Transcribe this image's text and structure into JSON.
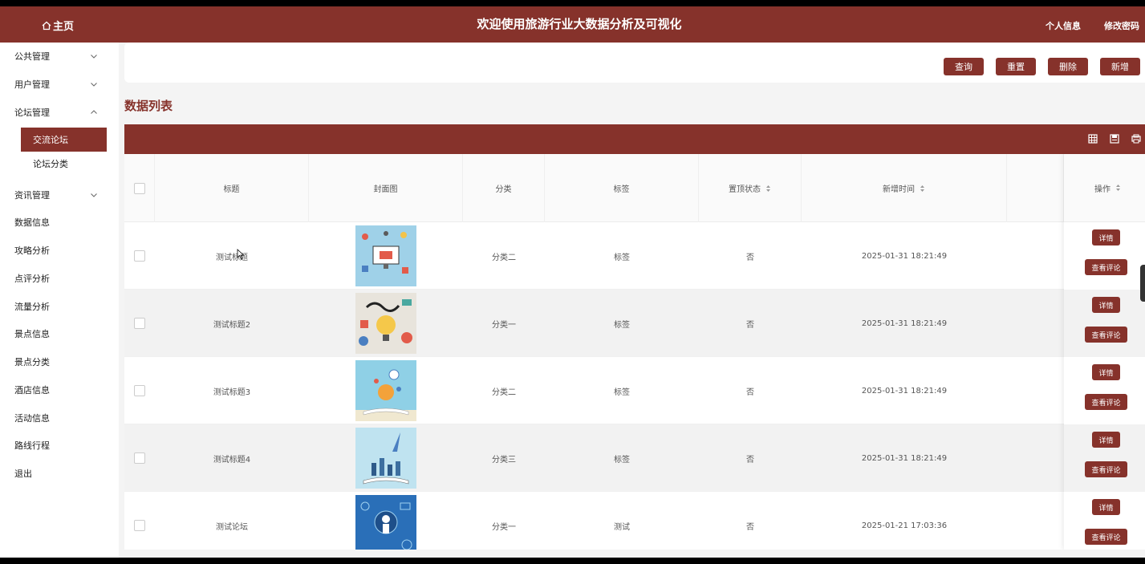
{
  "header": {
    "home_label": "主页",
    "title": "欢迎使用旅游行业大数据分析及可视化",
    "links": [
      "个人信息",
      "修改密码"
    ],
    "icon": "home-icon",
    "accent_color": "#86322b"
  },
  "sidebar": {
    "items": [
      {
        "label": "公共管理",
        "expand": "down"
      },
      {
        "label": "用户管理",
        "expand": "down"
      },
      {
        "label": "论坛管理",
        "expand": "up"
      },
      {
        "label": "资讯管理",
        "expand": "down"
      },
      {
        "label": "数据信息"
      },
      {
        "label": "攻略分析"
      },
      {
        "label": "点评分析"
      },
      {
        "label": "流量分析"
      },
      {
        "label": "景点信息"
      },
      {
        "label": "景点分类"
      },
      {
        "label": "酒店信息"
      },
      {
        "label": "活动信息"
      },
      {
        "label": "路线行程"
      },
      {
        "label": "退出"
      }
    ],
    "submenu": [
      {
        "label": "交流论坛",
        "active": true
      },
      {
        "label": "论坛分类",
        "active": false
      }
    ]
  },
  "toolbar": {
    "query": "查询",
    "reset": "重置",
    "delete": "删除",
    "add": "新增"
  },
  "list_title": "数据列表",
  "table": {
    "columns": [
      "标题",
      "封面图",
      "分类",
      "标签",
      "置顶状态",
      "新增时间",
      "操作"
    ],
    "rows": [
      {
        "title": "测试标题",
        "category": "分类二",
        "tag": "标签",
        "pinned": "否",
        "time": "2025-01-31 18:21:49"
      },
      {
        "title": "测试标题2",
        "category": "分类一",
        "tag": "标签",
        "pinned": "否",
        "time": "2025-01-31 18:21:49"
      },
      {
        "title": "测试标题3",
        "category": "分类二",
        "tag": "标签",
        "pinned": "否",
        "time": "2025-01-31 18:21:49"
      },
      {
        "title": "测试标题4",
        "category": "分类三",
        "tag": "标签",
        "pinned": "否",
        "time": "2025-01-31 18:21:49"
      },
      {
        "title": "测试论坛",
        "category": "分类一",
        "tag": "测试",
        "pinned": "否",
        "time": "2025-01-21 17:03:36"
      }
    ],
    "row_actions": {
      "detail": "详情",
      "comments": "查看评论"
    }
  }
}
